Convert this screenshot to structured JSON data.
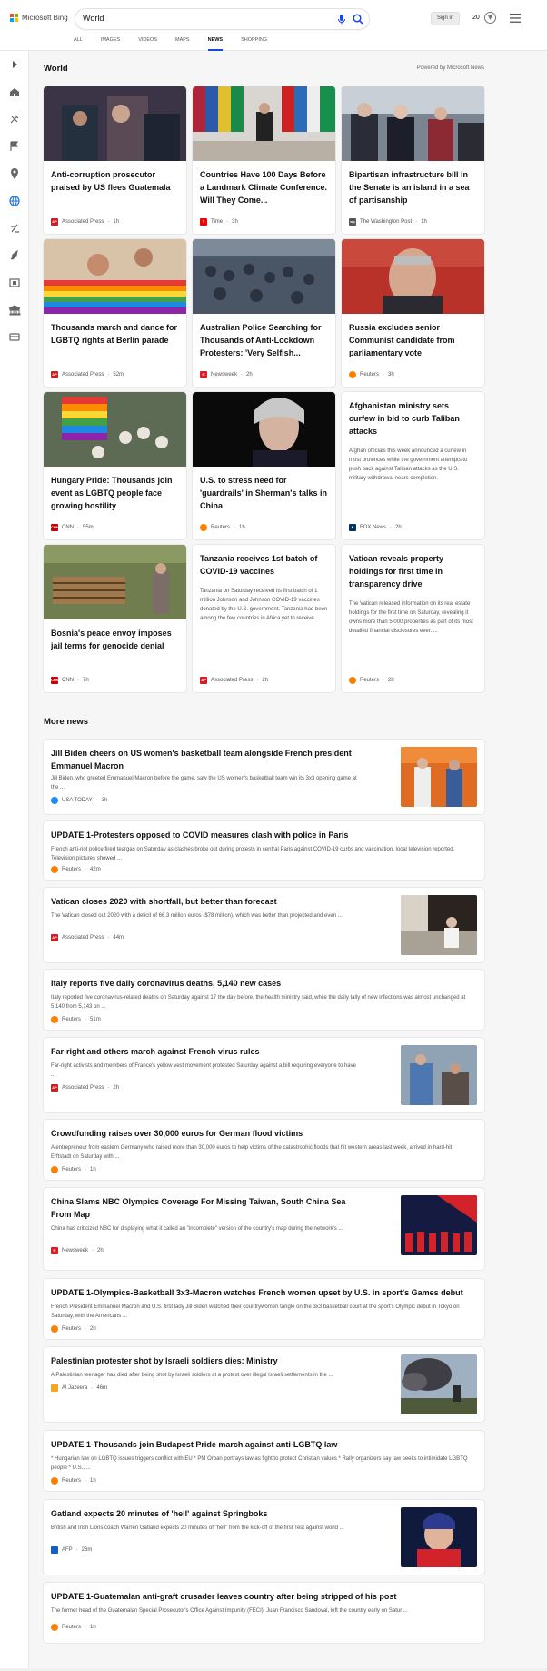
{
  "header": {
    "brand": "Microsoft Bing",
    "query": "World",
    "signin": "Sign in",
    "rewards": "20",
    "tabs": [
      "ALL",
      "IMAGES",
      "VIDEOS",
      "MAPS",
      "NEWS",
      "SHOPPING"
    ],
    "active_tab": "NEWS"
  },
  "brand_colors": {
    "red": "#f25022",
    "green": "#7fba00",
    "blue": "#00a4ef",
    "yellow": "#ffb900",
    "accent": "#174ae4"
  },
  "sidebar_icons": [
    "chevron-right-icon",
    "home-icon",
    "tools-icon",
    "flag-icon",
    "location-icon",
    "globe-icon",
    "science-icon",
    "rocket-icon",
    "film-icon",
    "bank-icon",
    "card-icon"
  ],
  "section": {
    "title": "World",
    "powered": "Powered by Microsoft News"
  },
  "cards": [
    {
      "title": "Anti-corruption prosecutor praised by US flees Guatemala",
      "source": "Associated Press",
      "time": "1h",
      "badge": "AP",
      "badge_color": "#d11e23"
    },
    {
      "title": "Countries Have 100 Days Before a Landmark Climate Conference. Will They Come...",
      "source": "Time",
      "time": "3h",
      "badge": "T",
      "badge_color": "#e90606"
    },
    {
      "title": "Bipartisan infrastructure bill in the Senate is an island in a sea of partisanship",
      "source": "The Washington Post",
      "time": "1h",
      "badge": "wp",
      "badge_color": "#555555"
    },
    {
      "title": "Thousands march and dance for LGBTQ rights at Berlin parade",
      "source": "Associated Press",
      "time": "52m",
      "badge": "AP",
      "badge_color": "#d11e23"
    },
    {
      "title": "Australian Police Searching for Thousands of Anti-Lockdown Protesters: 'Very Selfish...",
      "source": "Newsweek",
      "time": "2h",
      "badge": "N",
      "badge_color": "#e01b22"
    },
    {
      "title": "Russia excludes senior Communist candidate from parliamentary vote",
      "source": "Reuters",
      "time": "3h",
      "badge": "",
      "badge_color": "#ff8000"
    },
    {
      "title": "Hungary Pride: Thousands join event as LGBTQ people face growing hostility",
      "source": "CNN",
      "time": "55m",
      "badge": "CNN",
      "badge_color": "#cc0000"
    },
    {
      "title": "U.S. to stress need for 'guardrails' in Sherman's talks in China",
      "source": "Reuters",
      "time": "1h",
      "badge": "",
      "badge_color": "#ff8000"
    },
    {
      "title": "Afghanistan ministry sets curfew in bid to curb Taliban attacks",
      "desc": "Afghan officials this week announced a curfew in most provinces while the government attempts to push back against Taliban attacks as the U.S. military withdrawal nears completion.",
      "source": "FOX News",
      "time": "2h",
      "badge": "F",
      "badge_color": "#003366"
    },
    {
      "title": "Bosnia's peace envoy imposes jail terms for genocide denial",
      "source": "CNN",
      "time": "7h",
      "badge": "CNN",
      "badge_color": "#cc0000"
    },
    {
      "title": "Tanzania receives 1st batch of COVID-19 vaccines",
      "desc": "Tanzania on Saturday received its first batch of 1 million Johnson and Johnson COVID-19 vaccines donated by the U.S. government. Tanzania had been among the few countries in Africa yet to receive ...",
      "source": "Associated Press",
      "time": "2h",
      "badge": "AP",
      "badge_color": "#d11e23"
    },
    {
      "title": "Vatican reveals property holdings for first time in transparency drive",
      "desc": "The Vatican released information on its real estate holdings for the first time on Saturday, revealing it owns more than 5,000 properties as part of its most detailed financial disclosures ever. ...",
      "source": "Reuters",
      "time": "2h",
      "badge": "",
      "badge_color": "#ff8000"
    }
  ],
  "more": {
    "title": "More news",
    "items": [
      {
        "title": "Jill Biden cheers on US women's basketball team alongside French president Emmanuel Macron",
        "desc": "Jill Biden, who greeted Emmanuel Macron before the game, saw the US women's basketball team win its 3x3 opening game at the ...",
        "source": "USA TODAY",
        "time": "3h",
        "badge": "",
        "badge_color": "#1a8cff"
      },
      {
        "title": "UPDATE 1-Protesters opposed to COVID measures clash with police in Paris",
        "desc": "French anti-riot police fired teargas on Saturday as clashes broke out during protests in central Paris against COVID-19 curbs and vaccination, local television reported. Television pictures showed ...",
        "source": "Reuters",
        "time": "42m",
        "badge": "",
        "badge_color": "#ff8000"
      },
      {
        "title": "Vatican closes 2020 with shortfall, but better than forecast",
        "desc": "The Vatican closed out 2020 with a deficit of 66.3 million euros ($78 million), which was better than projected and even ...",
        "source": "Associated Press",
        "time": "44m",
        "badge": "AP",
        "badge_color": "#d11e23"
      },
      {
        "title": "Italy reports five daily coronavirus deaths, 5,140 new cases",
        "desc": "Italy reported five coronavirus-related deaths on Saturday against 17 the day before, the health ministry said, while the daily tally of new infections was almost unchanged at 5,140 from 5,143 on ...",
        "source": "Reuters",
        "time": "51m",
        "badge": "",
        "badge_color": "#ff8000"
      },
      {
        "title": "Far-right and others march against French virus rules",
        "desc": "Far-right activists and members of France's yellow vest movement protested Saturday against a bill requiring everyone to have ...",
        "source": "Associated Press",
        "time": "2h",
        "badge": "AP",
        "badge_color": "#d11e23"
      },
      {
        "title": "Crowdfunding raises over 30,000 euros for German flood victims",
        "desc": "A entrepreneur from eastern Germany who raised more than 30,000 euros to help victims of the catastrophic floods that hit western areas last week, arrived in hard-hit Erftstadt on Saturday with ...",
        "source": "Reuters",
        "time": "1h",
        "badge": "",
        "badge_color": "#ff8000"
      },
      {
        "title": "China Slams NBC Olympics Coverage For Missing Taiwan, South China Sea From Map",
        "desc": "China has criticized NBC for displaying what it called an \"incomplete\" version of the country's map during the network's ...",
        "source": "Newsweek",
        "time": "2h",
        "badge": "N",
        "badge_color": "#e01b22"
      },
      {
        "title": "UPDATE 1-Olympics-Basketball 3x3-Macron watches French women upset by U.S. in sport's Games debut",
        "desc": "French President Emmanuel Macron and U.S. first lady Jill Biden watched their countrywomen tangle on the 3x3 basketball court at the sport's Olympic debut in Tokyo on Saturday, with the Americans ...",
        "source": "Reuters",
        "time": "2h",
        "badge": "",
        "badge_color": "#ff8000"
      },
      {
        "title": "Palestinian protester shot by Israeli soldiers dies: Ministry",
        "desc": "A Palestinian teenager has died after being shot by Israeli soldiers at a protest over illegal Israeli settlements in the ...",
        "source": "Al Jazeera",
        "time": "46m",
        "badge": "",
        "badge_color": "#f5a623"
      },
      {
        "title": "UPDATE 1-Thousands join Budapest Pride march against anti-LGBTQ law",
        "desc": "* Hungarian law on LGBTQ issues triggers conflict with EU * PM Orban portrays law as fight to protect Christian values * Rally organizers say law seeks to intimidate LGBTQ people * U.S., ...",
        "source": "Reuters",
        "time": "1h",
        "badge": "",
        "badge_color": "#ff8000"
      },
      {
        "title": "Gatland expects 20 minutes of 'hell' against Springboks",
        "desc": "British and Irish Lions coach Warren Gatland expects 20 minutes of \"hell\" from the kick-off of the first Test against world ...",
        "source": "AFP",
        "time": "26m",
        "badge": "",
        "badge_color": "#1560bd"
      },
      {
        "title": "UPDATE 1-Guatemalan anti-graft crusader leaves country after being stripped of his post",
        "desc": "The former head of the Guatemalan Special Prosecutor's Office Against Impunity (FECI), Juan Francisco Sandoval, left the country early on Satur ...",
        "source": "Reuters",
        "time": "1h",
        "badge": "",
        "badge_color": "#ff8000"
      }
    ]
  }
}
